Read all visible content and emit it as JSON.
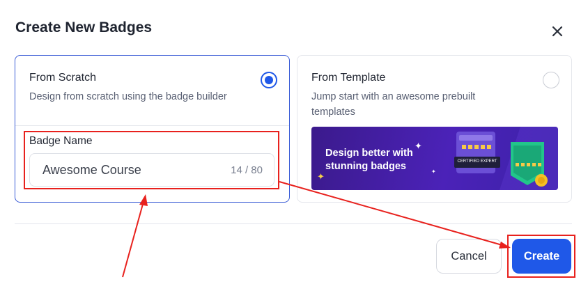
{
  "dialog": {
    "title": "Create New Badges",
    "close_icon": "close-icon"
  },
  "options": {
    "scratch": {
      "title": "From Scratch",
      "description": "Design from scratch using the badge builder",
      "selected": true,
      "badge_name_label": "Badge Name",
      "badge_name_value": "Awesome Course",
      "char_count": "14 / 80"
    },
    "template": {
      "title": "From Template",
      "description": "Jump start with an awesome prebuilt templates",
      "selected": false,
      "banner_text": "Design better with stunning badges",
      "banner_badge_caption": "CERTIFIED EXPERT"
    }
  },
  "footer": {
    "cancel_label": "Cancel",
    "create_label": "Create"
  },
  "colors": {
    "accent": "#1f58e8",
    "annotation": "#e8211d",
    "banner": "#4b22b8"
  }
}
